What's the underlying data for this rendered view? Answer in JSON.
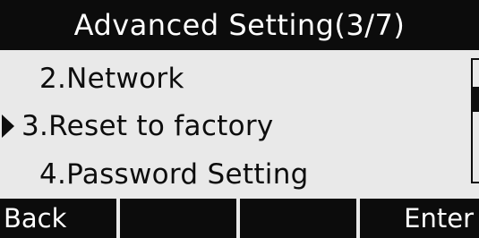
{
  "header": {
    "title": "Advanced Setting(3/7)"
  },
  "menu": {
    "items": [
      {
        "label": "2.Network",
        "selected": false
      },
      {
        "label": "3.Reset to factory",
        "selected": true
      },
      {
        "label": "4.Password Setting",
        "selected": false
      }
    ]
  },
  "softkeys": {
    "keys": [
      {
        "label": "Back"
      },
      {
        "label": ""
      },
      {
        "label": ""
      },
      {
        "label": "Enter"
      }
    ]
  },
  "colors": {
    "foreground": "#0d0d0d",
    "background": "#e9e9e9",
    "inverse_text": "#ffffff"
  },
  "icons": {
    "selection_marker": "right-triangle-icon"
  }
}
